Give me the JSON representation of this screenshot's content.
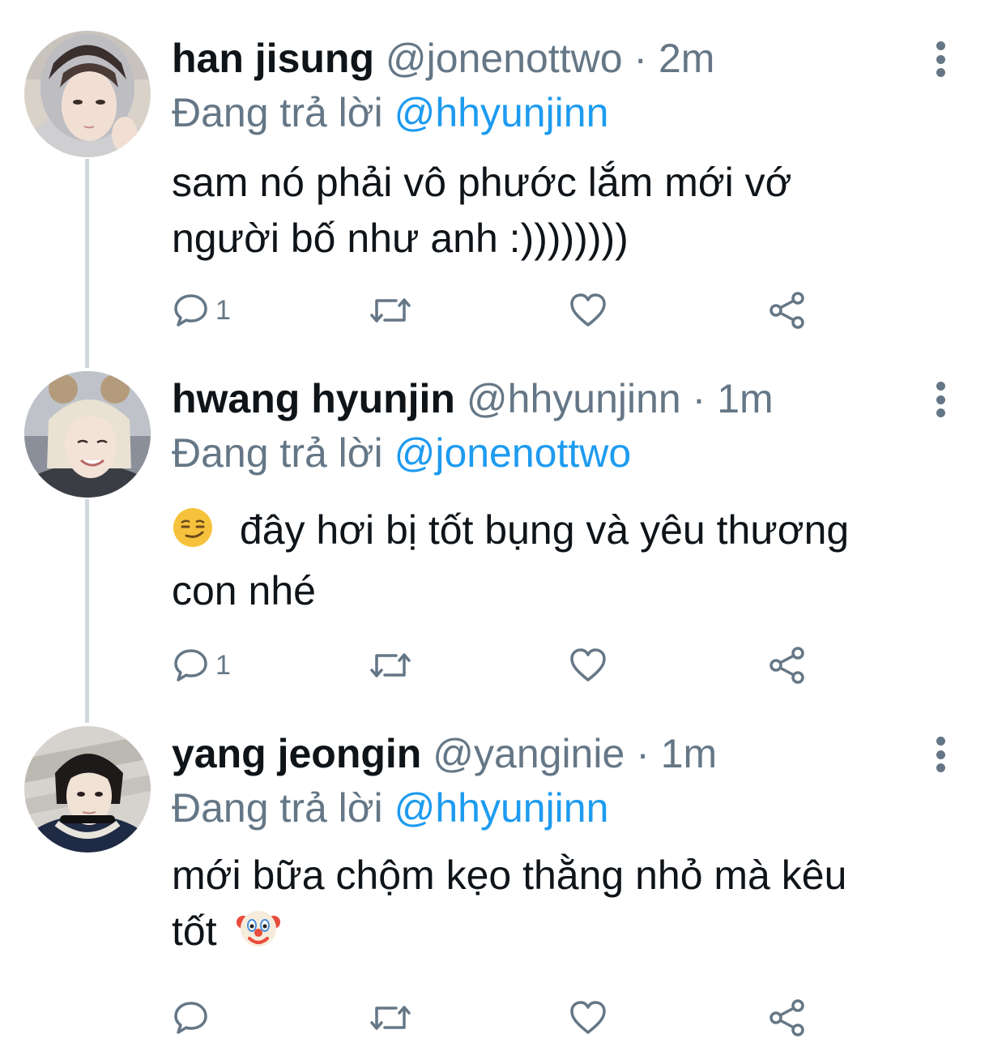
{
  "colors": {
    "name": "#0f1419",
    "meta": "#657786",
    "link": "#1d9bf0",
    "thread_line": "#cfd9de"
  },
  "tweets": [
    {
      "name": "han jisung",
      "handle": "@jonenottwo",
      "time": "2m",
      "reply_prefix": "Đang trả lời",
      "reply_to": "@hhyunjinn",
      "text_lines": [
        "sam nó phải vô phước lắm mới vớ",
        "người bố như anh :))))))))"
      ],
      "reply_count": "1",
      "avatar_icon": "avatar-photo"
    },
    {
      "name": "hwang hyunjin",
      "handle": "@hhyunjinn",
      "time": "1m",
      "reply_prefix": "Đang trả lời",
      "reply_to": "@jonenottwo",
      "text_lines": [
        "đây hơi bị tốt bụng và yêu thương",
        "con nhé"
      ],
      "emoji": "smirk-emoji",
      "reply_count": "1",
      "avatar_icon": "avatar-photo"
    },
    {
      "name": "yang jeongin",
      "handle": "@yanginie",
      "time": "1m",
      "reply_prefix": "Đang trả lời",
      "reply_to": "@hhyunjinn",
      "text_lines": [
        "mới bữa chộm kẹo thằng nhỏ mà kêu",
        "tốt"
      ],
      "emoji": "clown-emoji",
      "reply_count": "",
      "avatar_icon": "avatar-photo"
    }
  ]
}
